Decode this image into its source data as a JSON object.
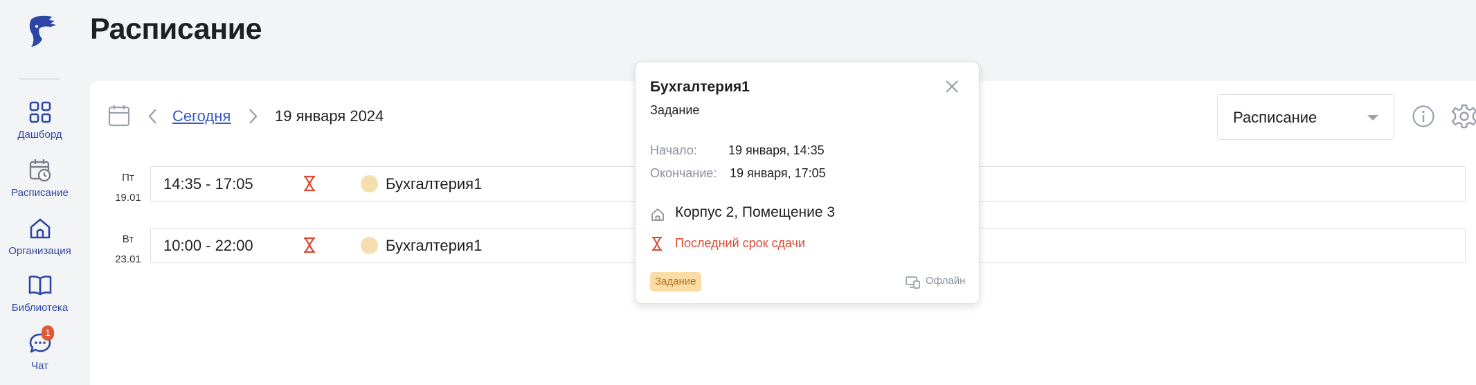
{
  "page": {
    "title": "Расписание"
  },
  "sidebar": {
    "items": [
      {
        "label": "Дашборд",
        "icon": "dashboard-grid-icon"
      },
      {
        "label": "Расписание",
        "icon": "calendar-clock-icon"
      },
      {
        "label": "Организация",
        "icon": "home-icon"
      },
      {
        "label": "Библиотека",
        "icon": "book-icon"
      },
      {
        "label": "Чат",
        "icon": "chat-icon",
        "badge": "1"
      }
    ]
  },
  "toolbar": {
    "today_label": "Сегодня",
    "current_date": "19 января 2024",
    "view_select_value": "Расписание"
  },
  "days": [
    {
      "dow": "Пт",
      "date": "19.01",
      "event": {
        "time": "14:35 - 17:05",
        "title": "Бухгалтерия1"
      }
    },
    {
      "dow": "Вт",
      "date": "23.01",
      "event": {
        "time": "10:00 - 22:00",
        "title": "Бухгалтерия1"
      }
    }
  ],
  "popover": {
    "title": "Бухгалтерия1",
    "type": "Задание",
    "start_label": "Начало:",
    "start_value": "19 января, 14:35",
    "end_label": "Окончание:",
    "end_value": "19 января, 17:05",
    "location": "Корпус 2, Помещение 3",
    "deadline": "Последний срок сдачи",
    "badge": "Задание",
    "format": "Офлайн"
  },
  "colors": {
    "accent": "#2d46a5",
    "link": "#3658c9",
    "deadline": "#d94a35",
    "badge_bg": "#fadca5",
    "event_dot": "#f5deb0"
  }
}
